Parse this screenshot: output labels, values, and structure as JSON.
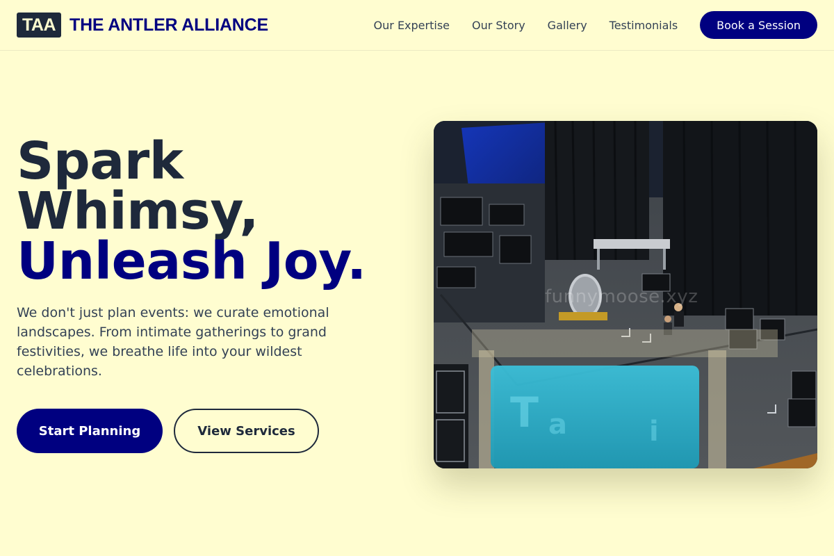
{
  "brand": {
    "logo_text": "TAA",
    "name": "THE ANTLER ALLIANCE"
  },
  "nav": {
    "links": [
      "Our Expertise",
      "Our Story",
      "Gallery",
      "Testimonials"
    ],
    "cta_label": "Book a Session"
  },
  "hero": {
    "headline_line1": "Spark",
    "headline_line2": "Whimsy,",
    "headline_accent": "Unleash Joy.",
    "lead": "We don't just plan events: we curate emotional landscapes. From intimate gatherings to grand festivities, we breathe life into your wildest celebrations.",
    "primary_button": "Start Planning",
    "secondary_button": "View Services",
    "image_watermark": "funnymoose.xyz"
  },
  "colors": {
    "background": "#FFFDD0",
    "brand_navy": "#000080",
    "text_dark": "#1e293b"
  }
}
